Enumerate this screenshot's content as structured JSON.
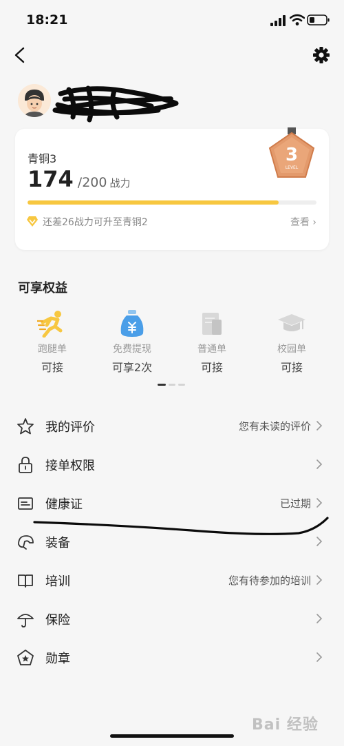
{
  "status_bar": {
    "time": "18:21"
  },
  "level_card": {
    "level_name": "青铜3",
    "score": "174",
    "score_total": "/200",
    "score_unit": "战力",
    "medal_number": "3",
    "medal_caption": "LEVEL",
    "progress_fraction": 0.87,
    "hint": "还差26战力可升至青铜2",
    "view_link": "查看 ›"
  },
  "benefits": {
    "title": "可享权益",
    "items": [
      {
        "label": "跑腿单",
        "status": "可接",
        "icon": "runner-icon"
      },
      {
        "label": "免费提现",
        "status": "可享2次",
        "icon": "money-bag-icon"
      },
      {
        "label": "普通单",
        "status": "可接",
        "icon": "document-icon"
      },
      {
        "label": "校园单",
        "status": "可接",
        "icon": "graduation-cap-icon"
      }
    ]
  },
  "menu": {
    "items": [
      {
        "label": "我的评价",
        "value": "您有未读的评价",
        "icon": "star-icon"
      },
      {
        "label": "接单权限",
        "value": "",
        "icon": "lock-icon"
      },
      {
        "label": "健康证",
        "value": "已过期",
        "icon": "id-card-icon"
      },
      {
        "label": "装备",
        "value": "",
        "icon": "helmet-icon"
      },
      {
        "label": "培训",
        "value": "您有待参加的培训",
        "icon": "book-icon"
      },
      {
        "label": "保险",
        "value": "",
        "icon": "umbrella-icon"
      },
      {
        "label": "勋章",
        "value": "",
        "icon": "medal-badge-icon"
      }
    ]
  },
  "watermark": "Bai 经验",
  "colors": {
    "accent_yellow": "#f7c740",
    "medal_bronze": "#e39a6c",
    "background": "#f6f6f6"
  }
}
